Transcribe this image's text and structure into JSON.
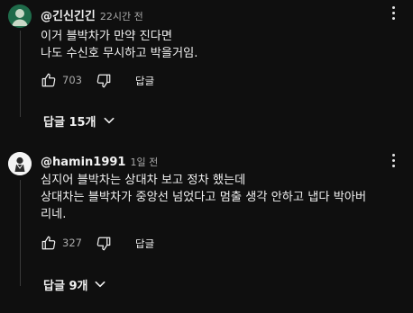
{
  "comments": [
    {
      "author": "@긴신긴긴",
      "time": "22시간 전",
      "lines": [
        "이거 블박차가 만약 진다면",
        "나도 수신호 무시하고 박을거임."
      ],
      "likes": "703",
      "reply_label": "답글",
      "replies_label": "답글 15개",
      "avatar_icon": "avatar-icon",
      "avatar_color": "#1f6b4a"
    },
    {
      "author": "@hamin1991",
      "time": "1일 전",
      "lines": [
        "심지어 블박차는 상대차 보고 정차 했는데",
        "상대차는 블박차가 중앙선 넘었다고 멈출 생각 안하고 냅다 박아버",
        "리네."
      ],
      "likes": "327",
      "reply_label": "답글",
      "replies_label": "답글 9개",
      "avatar_icon": "avatar-icon",
      "avatar_color": "#f4f4f4"
    }
  ],
  "icons": {
    "like": "thumb-up-icon",
    "dislike": "thumb-down-icon",
    "more": "more-vert-icon",
    "expand": "chevron-down-icon"
  },
  "colors": {
    "background": "#0f0f0f",
    "text_primary": "#f1f1f1",
    "text_secondary": "#aaaaaa"
  }
}
